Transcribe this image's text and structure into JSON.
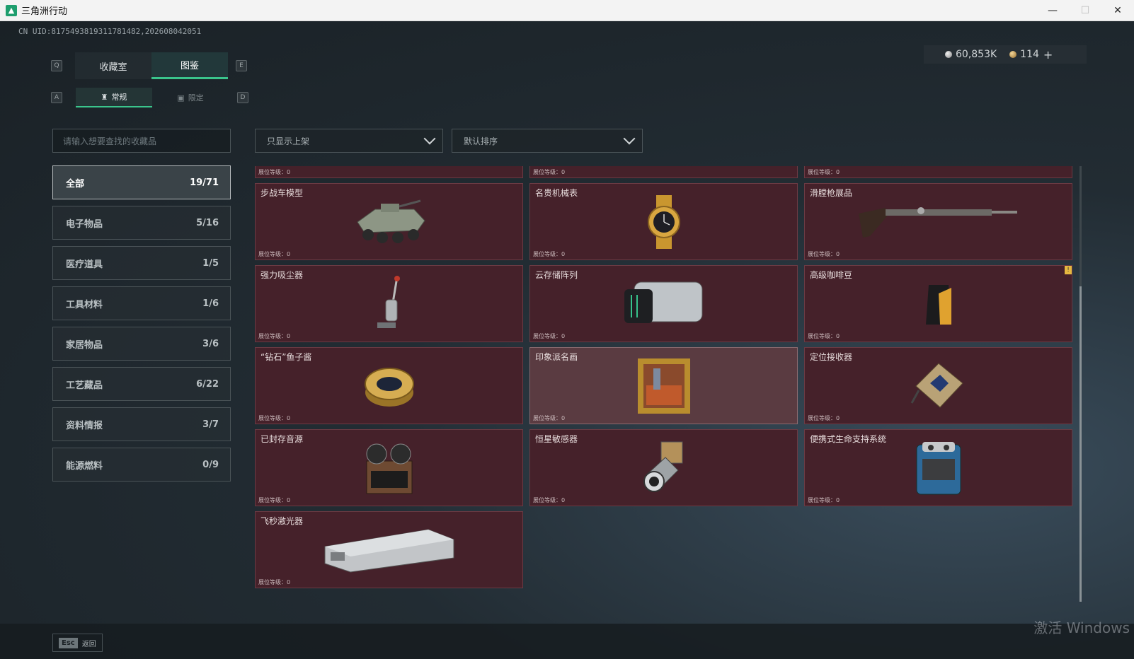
{
  "window": {
    "title": "三角洲行动",
    "minimize": "—",
    "maximize": "☐",
    "close": "✕"
  },
  "uid": "CN UID:8175493819311781482,202608042051",
  "currency": {
    "silver": "60,853K",
    "gold": "114",
    "add": "+"
  },
  "tabs": {
    "key_left": "Q",
    "key_right": "E",
    "items": [
      {
        "label": "收藏室"
      },
      {
        "label": "图鉴"
      }
    ]
  },
  "subtabs": {
    "key_left": "A",
    "key_right": "D",
    "items": [
      {
        "label": "常规"
      },
      {
        "label": "限定"
      }
    ]
  },
  "search": {
    "placeholder": "请输入想要查找的收藏品"
  },
  "categories": [
    {
      "label": "全部",
      "count": "19/71"
    },
    {
      "label": "电子物品",
      "count": "5/16"
    },
    {
      "label": "医疗道具",
      "count": "1/5"
    },
    {
      "label": "工具材料",
      "count": "1/6"
    },
    {
      "label": "家居物品",
      "count": "3/6"
    },
    {
      "label": "工艺藏品",
      "count": "6/22"
    },
    {
      "label": "资料情报",
      "count": "3/7"
    },
    {
      "label": "能源燃料",
      "count": "0/9"
    }
  ],
  "filters": {
    "shelf": "只显示上架",
    "sort": "默认排序"
  },
  "level_label": "展位等级：0",
  "items": [
    {
      "name": "步战车模型"
    },
    {
      "name": "名贵机械表"
    },
    {
      "name": "滑膛枪展品"
    },
    {
      "name": "强力吸尘器"
    },
    {
      "name": "云存储阵列"
    },
    {
      "name": "高级咖啡豆"
    },
    {
      "name": "“钻石”鱼子酱"
    },
    {
      "name": "印象派名画"
    },
    {
      "name": "定位接收器"
    },
    {
      "name": "已封存音源"
    },
    {
      "name": "恒星敏感器"
    },
    {
      "name": "便携式生命支持系统"
    },
    {
      "name": "飞秒激光器"
    }
  ],
  "footer": {
    "esc_key": "Esc",
    "back": "返回"
  },
  "watermark": "激活 Windows",
  "colors": {
    "accent": "#3ac58c",
    "card_bg": "#45212a"
  }
}
